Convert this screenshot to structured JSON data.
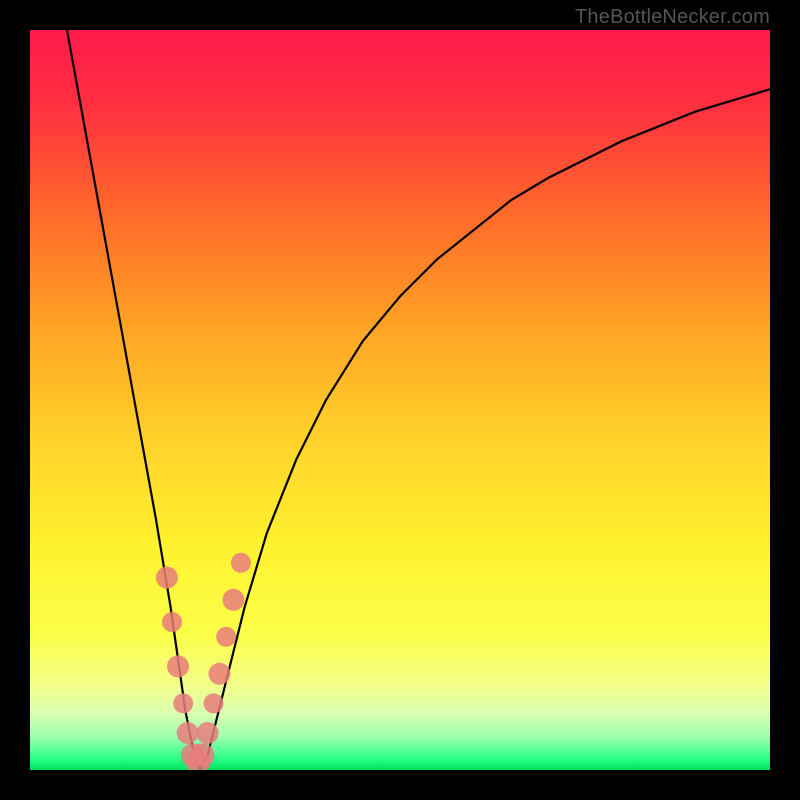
{
  "attribution": "TheBottleNecker.com",
  "colors": {
    "frame": "#000000",
    "curve": "#000000",
    "marker_fill": "#e77d7d",
    "marker_stroke": "#c76666",
    "gradient_top": "#ff1744",
    "gradient_mid_upper": "#ff8a2a",
    "gradient_mid": "#ffe62e",
    "gradient_lower": "#f7ff6a",
    "gradient_bottom": "#00e676"
  },
  "chart_data": {
    "type": "line",
    "title": "",
    "xlabel": "",
    "ylabel": "",
    "xlim": [
      0,
      100
    ],
    "ylim": [
      0,
      100
    ],
    "series": [
      {
        "name": "bottleneck-curve",
        "x": [
          5,
          7,
          9,
          11,
          13,
          15,
          17,
          19,
          20,
          21,
          22,
          23,
          24,
          25,
          27,
          29,
          32,
          36,
          40,
          45,
          50,
          55,
          60,
          65,
          70,
          75,
          80,
          85,
          90,
          95,
          100
        ],
        "y": [
          100,
          89,
          78,
          67,
          56,
          45,
          34,
          22,
          15,
          8,
          3,
          0,
          2,
          6,
          14,
          22,
          32,
          42,
          50,
          58,
          64,
          69,
          73,
          77,
          80,
          82.5,
          85,
          87,
          89,
          90.5,
          92
        ]
      }
    ],
    "markers": {
      "name": "highlighted-points",
      "x": [
        18.5,
        19.2,
        20.0,
        20.7,
        21.3,
        22.0,
        22.7,
        23.3,
        24.0,
        24.8,
        25.6,
        26.5,
        27.5,
        28.5
      ],
      "y": [
        26,
        20,
        14,
        9,
        5,
        2,
        1,
        2,
        5,
        9,
        13,
        18,
        23,
        28
      ],
      "r": [
        11,
        10,
        11,
        10,
        11,
        12,
        12,
        12,
        11,
        10,
        11,
        10,
        11,
        10
      ]
    },
    "gradient_stops": [
      {
        "pos": 0.0,
        "color": "#ff1a4b"
      },
      {
        "pos": 0.1,
        "color": "#ff2f40"
      },
      {
        "pos": 0.25,
        "color": "#ff6a2a"
      },
      {
        "pos": 0.4,
        "color": "#ffa325"
      },
      {
        "pos": 0.55,
        "color": "#ffd12a"
      },
      {
        "pos": 0.7,
        "color": "#fff22f"
      },
      {
        "pos": 0.82,
        "color": "#fbff4a"
      },
      {
        "pos": 0.885,
        "color": "#f3ff8a"
      },
      {
        "pos": 0.925,
        "color": "#d8ffb0"
      },
      {
        "pos": 0.955,
        "color": "#9effb0"
      },
      {
        "pos": 0.985,
        "color": "#2bff88"
      },
      {
        "pos": 1.0,
        "color": "#00e05e"
      }
    ]
  }
}
